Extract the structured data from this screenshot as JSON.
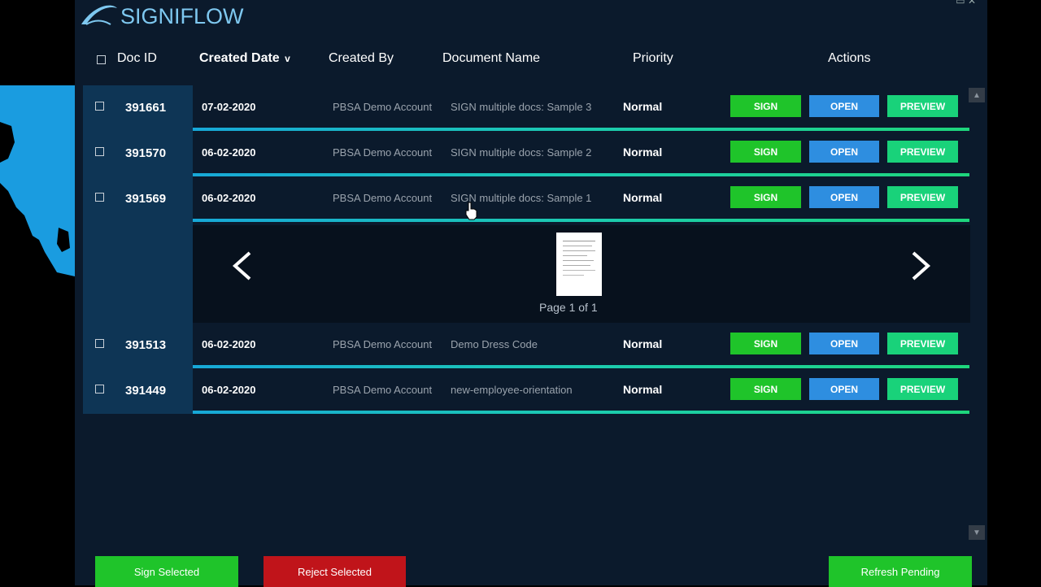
{
  "app": {
    "logo_text": "SIGNIFLOW"
  },
  "header": {
    "doc_id": "Doc ID",
    "created_date": "Created Date",
    "sort_indicator": "v",
    "created_by": "Created By",
    "document_name": "Document Name",
    "priority": "Priority",
    "actions": "Actions"
  },
  "rows": [
    {
      "id": "391661",
      "date": "07-02-2020",
      "by": "PBSA Demo Account",
      "name": "SIGN multiple docs: Sample 3",
      "priority": "Normal"
    },
    {
      "id": "391570",
      "date": "06-02-2020",
      "by": "PBSA Demo Account",
      "name": "SIGN multiple docs: Sample 2",
      "priority": "Normal"
    },
    {
      "id": "391569",
      "date": "06-02-2020",
      "by": "PBSA Demo Account",
      "name": "SIGN multiple docs: Sample 1",
      "priority": "Normal"
    },
    {
      "id": "391513",
      "date": "06-02-2020",
      "by": "PBSA Demo Account",
      "name": "Demo Dress Code",
      "priority": "Normal"
    },
    {
      "id": "391449",
      "date": "06-02-2020",
      "by": "PBSA Demo Account",
      "name": "new-employee-orientation",
      "priority": "Normal"
    }
  ],
  "actions": {
    "sign": "SIGN",
    "open": "OPEN",
    "preview": "PREVIEW"
  },
  "preview": {
    "page_label": "Page 1 of 1"
  },
  "footer": {
    "sign_selected": "Sign Selected",
    "reject_selected": "Reject Selected",
    "refresh_pending": "Refresh Pending"
  },
  "colors": {
    "sign": "#1fc42a",
    "open": "#2e8ee0",
    "preview": "#19d27a",
    "reject": "#c0141a",
    "accent": "#17a8d8"
  },
  "icons": [
    "checkbox-icon",
    "chevron-left-icon",
    "chevron-right-icon",
    "scroll-up-icon",
    "scroll-down-icon",
    "cursor-icon"
  ]
}
